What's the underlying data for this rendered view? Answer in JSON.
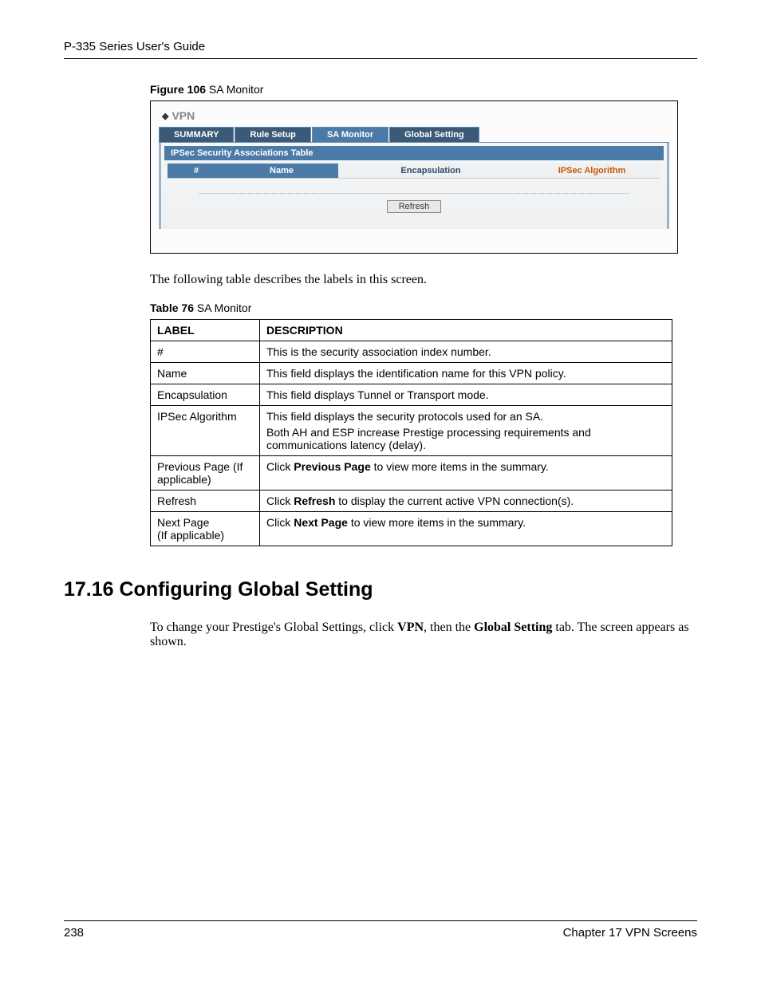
{
  "header": "P-335 Series User's Guide",
  "figure": {
    "label_bold": "Figure 106",
    "label_rest": "   SA Monitor"
  },
  "screenshot": {
    "section_title": "VPN",
    "tabs": [
      {
        "label": "SUMMARY",
        "active": false
      },
      {
        "label": "Rule Setup",
        "active": false
      },
      {
        "label": "SA Monitor",
        "active": true
      },
      {
        "label": "Global Setting",
        "active": false
      }
    ],
    "panel_title": "IPSec Security Associations Table",
    "columns": {
      "idx": "#",
      "name": "Name",
      "enc": "Encapsulation",
      "alg": "IPSec Algorithm"
    },
    "refresh_label": "Refresh"
  },
  "intro_text": "The following table describes the labels in this screen.",
  "table_label": {
    "bold": "Table 76",
    "rest": "   SA Monitor"
  },
  "desc_table": {
    "headers": {
      "label": "LABEL",
      "description": "DESCRIPTION"
    },
    "rows": [
      {
        "label": "#",
        "desc": [
          "This is the security association index number."
        ]
      },
      {
        "label": "Name",
        "desc": [
          "This field displays the identification name for this VPN policy."
        ]
      },
      {
        "label": "Encapsulation",
        "desc": [
          "This field displays Tunnel or Transport mode."
        ]
      },
      {
        "label": "IPSec Algorithm",
        "desc": [
          "This field displays the security protocols used for an SA.",
          "Both AH and ESP increase Prestige processing requirements and communications latency (delay)."
        ]
      },
      {
        "label": "Previous Page (If applicable)",
        "desc_html": "Click <b>Previous Page</b> to view more items in the summary."
      },
      {
        "label": "Refresh",
        "desc_html": "Click <b>Refresh</b> to display the current active VPN connection(s)."
      },
      {
        "label": "Next Page\n(If applicable)",
        "desc_html": "Click <b>Next Page</b> to view more items in the summary."
      }
    ]
  },
  "section_heading": "17.16  Configuring Global Setting",
  "section_body_html": "To change your Prestige's Global Settings, click <b>VPN</b>, then the <b>Global Setting</b> tab. The screen appears as shown.",
  "footer": {
    "page": "238",
    "chapter": "Chapter 17 VPN Screens"
  }
}
